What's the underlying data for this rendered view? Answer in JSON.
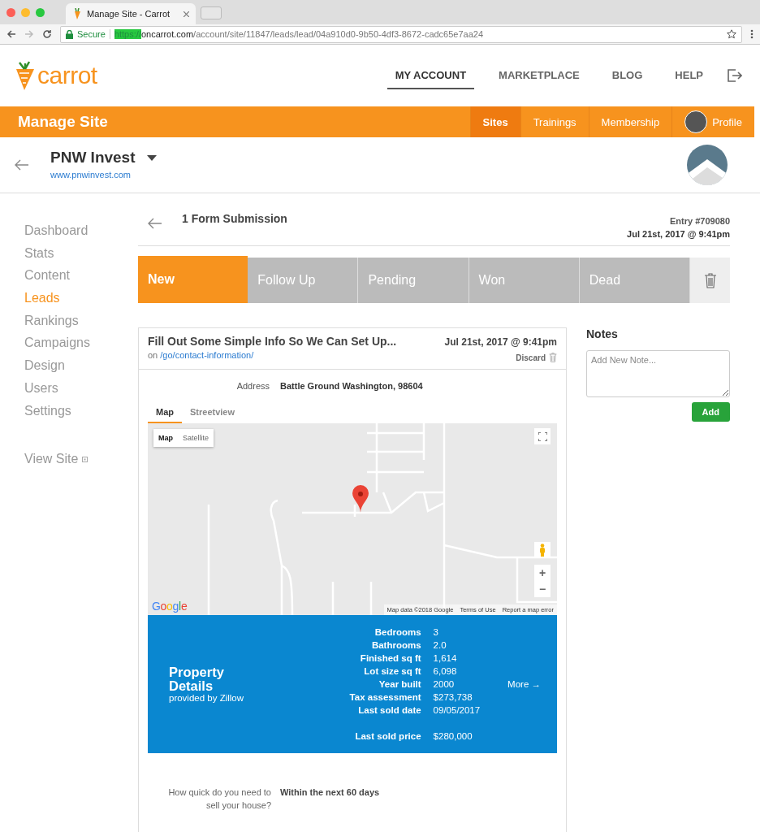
{
  "browser": {
    "tab_title": "Manage Site - Carrot",
    "secure_label": "Secure",
    "url_scheme": "https://",
    "url_domain": "oncarrot.com",
    "url_path": "/account/site/11847/leads/lead/04a910d0-9b50-4df3-8672-cadc65e7aa24"
  },
  "header": {
    "logo": "carrot",
    "nav": [
      {
        "label": "MY ACCOUNT",
        "selected": true
      },
      {
        "label": "MARKETPLACE",
        "selected": false
      },
      {
        "label": "BLOG",
        "selected": false
      },
      {
        "label": "HELP",
        "selected": false
      }
    ]
  },
  "manage_bar": {
    "title": "Manage Site",
    "nav": [
      {
        "label": "Sites",
        "selected": true,
        "kind": "text"
      },
      {
        "label": "Trainings",
        "selected": false,
        "kind": "text"
      },
      {
        "label": "Membership",
        "selected": false,
        "kind": "text"
      },
      {
        "label": "Profile",
        "selected": false,
        "kind": "avatar"
      }
    ]
  },
  "site": {
    "name": "PNW Invest",
    "url": "www.pnwinvest.com"
  },
  "sidebar": {
    "items": [
      {
        "label": "Dashboard",
        "selected": false
      },
      {
        "label": "Stats",
        "selected": false
      },
      {
        "label": "Content",
        "selected": false
      },
      {
        "label": "Leads",
        "selected": true
      },
      {
        "label": "Rankings",
        "selected": false
      },
      {
        "label": "Campaigns",
        "selected": false
      },
      {
        "label": "Design",
        "selected": false
      },
      {
        "label": "Users",
        "selected": false
      },
      {
        "label": "Settings",
        "selected": false
      }
    ],
    "view_site": "View Site"
  },
  "submission": {
    "title": "1 Form Submission",
    "entry": "Entry #709080",
    "date": "Jul 21st, 2017 @ 9:41pm"
  },
  "status_tabs": [
    {
      "label": "New",
      "selected": true
    },
    {
      "label": "Follow Up",
      "selected": false
    },
    {
      "label": "Pending",
      "selected": false
    },
    {
      "label": "Won",
      "selected": false
    },
    {
      "label": "Dead",
      "selected": false
    }
  ],
  "card": {
    "title": "Fill Out Some Simple Info So We Can Set Up...",
    "on": "on",
    "page_link": "/go/contact-information/",
    "date": "Jul 21st, 2017 @ 9:41pm",
    "discard": "Discard",
    "address_label": "Address",
    "address_value": "Battle Ground Washington, 98604",
    "map_tabs": [
      {
        "label": "Map",
        "selected": true
      },
      {
        "label": "Streetview",
        "selected": false
      }
    ],
    "map": {
      "logo": "Google",
      "type_buttons": [
        {
          "label": "Map",
          "selected": true
        },
        {
          "label": "Satellite",
          "selected": false
        }
      ],
      "attribution": "Map data ©2018 Google",
      "terms": "Terms of Use",
      "report": "Report a map error",
      "zoom_in": "+",
      "zoom_out": "−"
    },
    "property": {
      "title": "Property Details",
      "subtitle": "provided by Zillow",
      "more": "More →",
      "rows": [
        {
          "label": "Bedrooms",
          "value": "3"
        },
        {
          "label": "Bathrooms",
          "value": "2.0"
        },
        {
          "label": "Finished sq ft",
          "value": "1,614"
        },
        {
          "label": "Lot size sq ft",
          "value": "6,098"
        },
        {
          "label": "Year built",
          "value": "2000"
        },
        {
          "label": "Tax assessment",
          "value": "$273,738"
        },
        {
          "label": "Last sold date",
          "value": "09/05/2017"
        },
        {
          "label": "Last sold price",
          "value": "$280,000"
        }
      ]
    },
    "qa": [
      {
        "question": "How quick do you need to sell your house?",
        "answer": "Within the next 60 days"
      }
    ]
  },
  "notes": {
    "title": "Notes",
    "placeholder": "Add New Note...",
    "add": "Add"
  }
}
